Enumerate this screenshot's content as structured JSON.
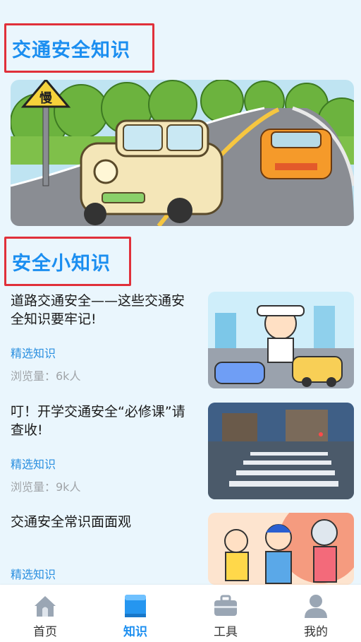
{
  "sections": {
    "knowledge_title": "交通安全知识",
    "tips_title": "安全小知识"
  },
  "banner": {
    "sign_text": "慢"
  },
  "articles": [
    {
      "title": "道路交通安全——这些交通安全知识要牢记!",
      "tag": "精选知识",
      "views": "浏览量：6k人"
    },
    {
      "title": "叮！开学交通安全“必修课”请查收!",
      "tag": "精选知识",
      "views": "浏览量：9k人"
    },
    {
      "title": "交通安全常识面面观",
      "tag": "精选知识"
    }
  ],
  "tabbar": [
    {
      "label": "首页",
      "icon": "home-icon"
    },
    {
      "label": "知识",
      "icon": "book-icon",
      "active": true
    },
    {
      "label": "工具",
      "icon": "toolbox-icon"
    },
    {
      "label": "我的",
      "icon": "user-icon"
    }
  ],
  "colors": {
    "accent": "#1b8ef0",
    "highlight_border": "#e0303a",
    "tag": "#2a8fe0"
  }
}
